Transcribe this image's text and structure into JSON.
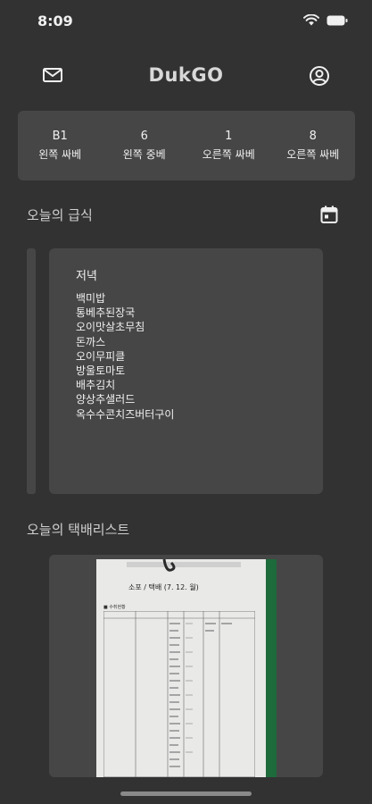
{
  "status": {
    "time": "8:09"
  },
  "header": {
    "title": "DukGO"
  },
  "counters": [
    {
      "value": "B1",
      "label": "왼쪽 싸베"
    },
    {
      "value": "6",
      "label": "왼쪽 중베"
    },
    {
      "value": "1",
      "label": "오른쪽 싸베"
    },
    {
      "value": "8",
      "label": "오른쪽 싸베"
    }
  ],
  "meal": {
    "section_title": "오늘의 급식",
    "type": "저녁",
    "items": [
      "백미밥",
      "통베추된장국",
      "오이맛살초무침",
      "돈까스",
      "오이무피클",
      "방울토마토",
      "배추김치",
      "양상추샐러드",
      "옥수수콘치즈버터구이"
    ]
  },
  "delivery": {
    "section_title": "오늘의 택배리스트",
    "photo_title": "소포 / 택배 (7. 12. 월)"
  },
  "colors": {
    "background": "#323232",
    "card": "#464646",
    "text": "#f0f0f0"
  }
}
